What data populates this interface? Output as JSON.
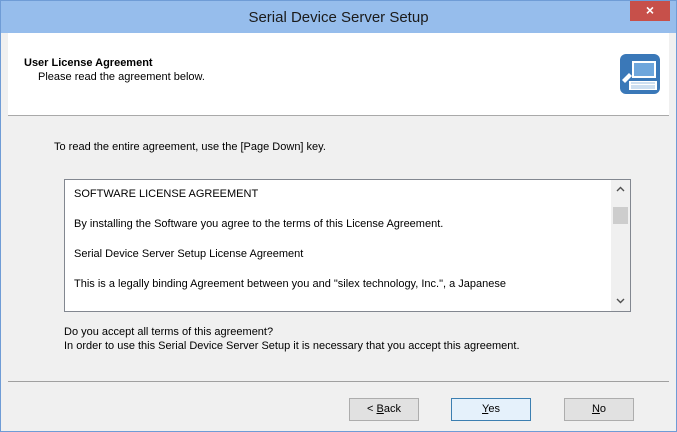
{
  "window": {
    "title": "Serial Device Server Setup",
    "close_glyph": "×"
  },
  "header": {
    "title": "User License Agreement",
    "subtitle": "Please read the agreement below.",
    "icon": "computer-setup-icon"
  },
  "body": {
    "instruction": "To read the entire agreement, use the [Page Down] key.",
    "license_lines": [
      "SOFTWARE LICENSE AGREEMENT",
      "By installing the Software you agree to the terms of this License Agreement.",
      "Serial Device Server Setup License Agreement",
      "This is a legally binding Agreement between you and \"silex technology, Inc.\", a Japanese"
    ],
    "accept_question": "Do you accept all terms of this agreement?",
    "accept_note": "In order to use this Serial Device Server Setup it is necessary that you accept this agreement."
  },
  "buttons": {
    "back_prefix": "< ",
    "back_mnemonic": "B",
    "back_rest": "ack",
    "yes_mnemonic": "Y",
    "yes_rest": "es",
    "no_mnemonic": "N",
    "no_rest": "o"
  },
  "colors": {
    "titlebar": "#96bdec",
    "close_button": "#c7504a",
    "default_button_border": "#3c7fb1"
  }
}
